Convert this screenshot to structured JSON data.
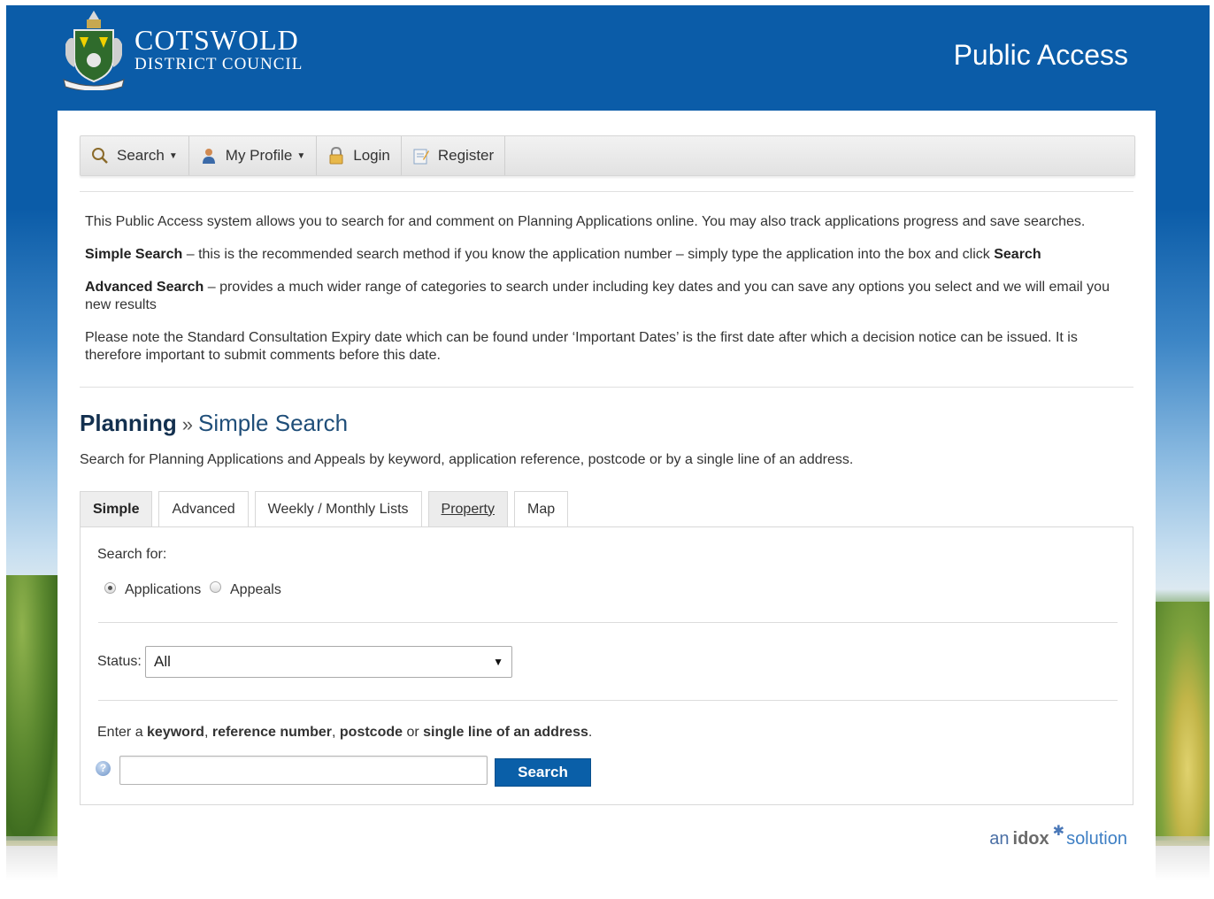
{
  "header": {
    "council_line1": "COTSWOLD",
    "council_line2": "DISTRICT COUNCIL",
    "title": "Public Access"
  },
  "nav": {
    "search": "Search",
    "profile": "My Profile",
    "login": "Login",
    "register": "Register"
  },
  "intro": {
    "p1": "This Public Access system allows you to search for and comment on Planning Applications online. You may also track applications progress and save searches.",
    "p2_strong": "Simple Search",
    "p2_text": " – this is the recommended search method if you know the application number – simply type the application into the box and click ",
    "p2_strong2": "Search",
    "p3_strong": "Advanced Search",
    "p3_text": " – provides a much wider range of categories to search under including key dates and you can save any options you select and we will email you new results",
    "p4": "Please note the Standard Consultation Expiry  date which can be found under ‘Important Dates’ is the first date after which a decision notice can be issued. It is therefore important to submit comments before this date."
  },
  "page": {
    "crumb_strong": "Planning",
    "crumb_sep": "»",
    "crumb_rest": "Simple Search",
    "description": "Search for Planning Applications and Appeals by keyword, application reference, postcode or by a single line of an address."
  },
  "tabs": [
    "Simple",
    "Advanced",
    "Weekly / Monthly Lists",
    "Property",
    "Map"
  ],
  "form": {
    "search_for_label": "Search for:",
    "radio_applications": "Applications",
    "radio_appeals": "Appeals",
    "selected_type": "Applications",
    "status_label": "Status:",
    "status_value": "All",
    "keyword_prefix": "Enter a ",
    "keyword_b1": "keyword",
    "keyword_sep1": ", ",
    "keyword_b2": "reference number",
    "keyword_sep2": ", ",
    "keyword_b3": "postcode",
    "keyword_mid": " or ",
    "keyword_b4": "single line of an address",
    "keyword_end": ".",
    "search_value": "",
    "search_button": "Search"
  },
  "footer": {
    "brand_an": "an",
    "brand_idox": "idox",
    "brand_solution": "solution"
  },
  "colors": {
    "header_blue": "#0b5ca8",
    "button_blue": "#0a5fa8"
  }
}
